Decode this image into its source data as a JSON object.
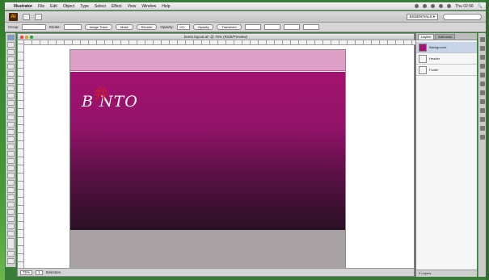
{
  "menubar": {
    "items": [
      "Illustrator",
      "File",
      "Edit",
      "Object",
      "Type",
      "Select",
      "Effect",
      "View",
      "Window",
      "Help"
    ],
    "clock": "Thu 02:56"
  },
  "appbar": {
    "logo": "Ai",
    "workspace": "ESSENTIALS ▾"
  },
  "controlbar": {
    "label": "Group",
    "stroke": "Stroke:",
    "opacity_label": "Opacity:",
    "opacity": "100",
    "buttons": [
      "Image Trace",
      "Mask",
      "Recolor",
      "Opacity",
      "Transform"
    ]
  },
  "document": {
    "title": "bento layout.ai* @ 75% (RGB/Preview)",
    "logo_text": "B NTO",
    "logo_glyph": "弁",
    "zoom": "75%",
    "page": "1",
    "status": "Selection"
  },
  "panel": {
    "tabs": [
      "Layers",
      "Artboards"
    ],
    "layers": [
      "Background",
      "Header",
      "Footer"
    ],
    "footer": "3 Layers"
  },
  "colors": {
    "magenta": "#a2126f",
    "pink_band": "#dfa0c8",
    "grey_band": "#a8a2a5",
    "logo_red": "#c11b3a"
  }
}
